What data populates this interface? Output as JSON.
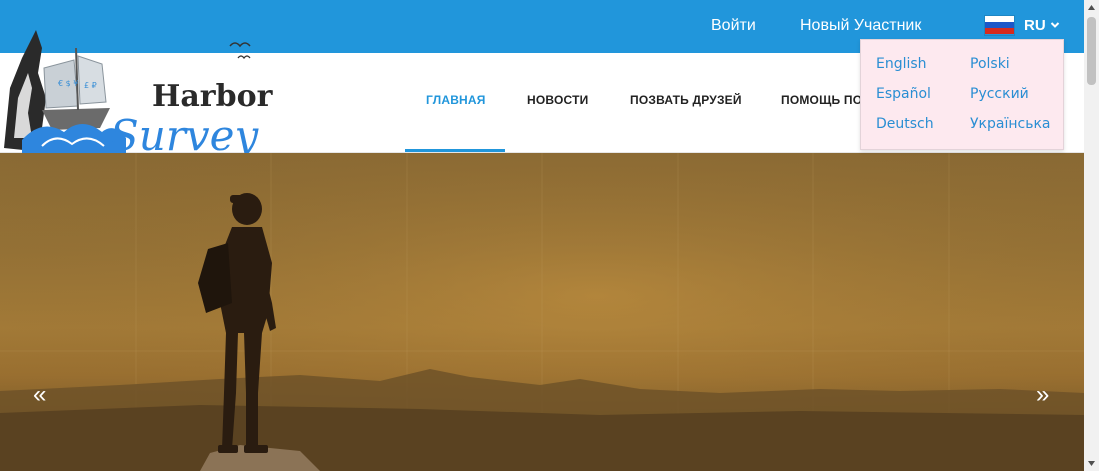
{
  "topbar": {
    "login_label": "Войти",
    "new_member_label": "Новый Участник",
    "lang_code": "RU",
    "accent_color": "#2196db"
  },
  "logo": {
    "line1": "Harbor",
    "line2": "Survey",
    "icon": "sailing-ship-logo"
  },
  "nav": {
    "items": [
      {
        "label": "ГЛАВНАЯ",
        "active": true
      },
      {
        "label": "НОВОСТИ",
        "active": false
      },
      {
        "label": "ПОЗВАТЬ ДРУЗЕЙ",
        "active": false
      },
      {
        "label": "ПОМОЩЬ ПО",
        "active": false
      }
    ]
  },
  "language_menu": {
    "options": [
      "English",
      "Polski",
      "Español",
      "Русский",
      "Deutsch",
      "Українська"
    ],
    "selected": "Русский"
  },
  "hero": {
    "prev_icon": "double-chevron-left-icon",
    "next_icon": "double-chevron-right-icon",
    "prev_glyph": "«",
    "next_glyph": "»"
  }
}
